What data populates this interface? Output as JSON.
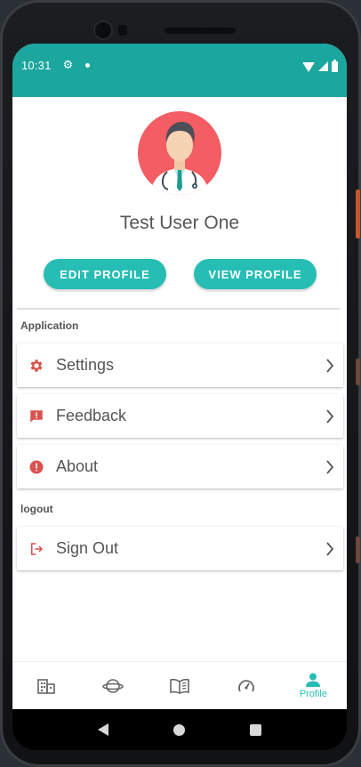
{
  "status_bar": {
    "time": "10:31"
  },
  "profile": {
    "name": "Test User One",
    "edit_label": "EDIT PROFILE",
    "view_label": "VIEW PROFILE"
  },
  "sections": {
    "application": "Application",
    "logout": "logout"
  },
  "items": {
    "settings": "Settings",
    "feedback": "Feedback",
    "about": "About",
    "signout": "Sign Out"
  },
  "bottom_nav": {
    "profile_label": "Profile",
    "icons": [
      "building-icon",
      "planet-icon",
      "book-icon",
      "dashboard-icon",
      "person-icon"
    ],
    "active_color": "#26bdb4"
  },
  "colors": {
    "header": "#1ba69e",
    "accent": "#26bdb4",
    "icon_red": "#d9534f",
    "avatar_bg": "#f35d63"
  }
}
